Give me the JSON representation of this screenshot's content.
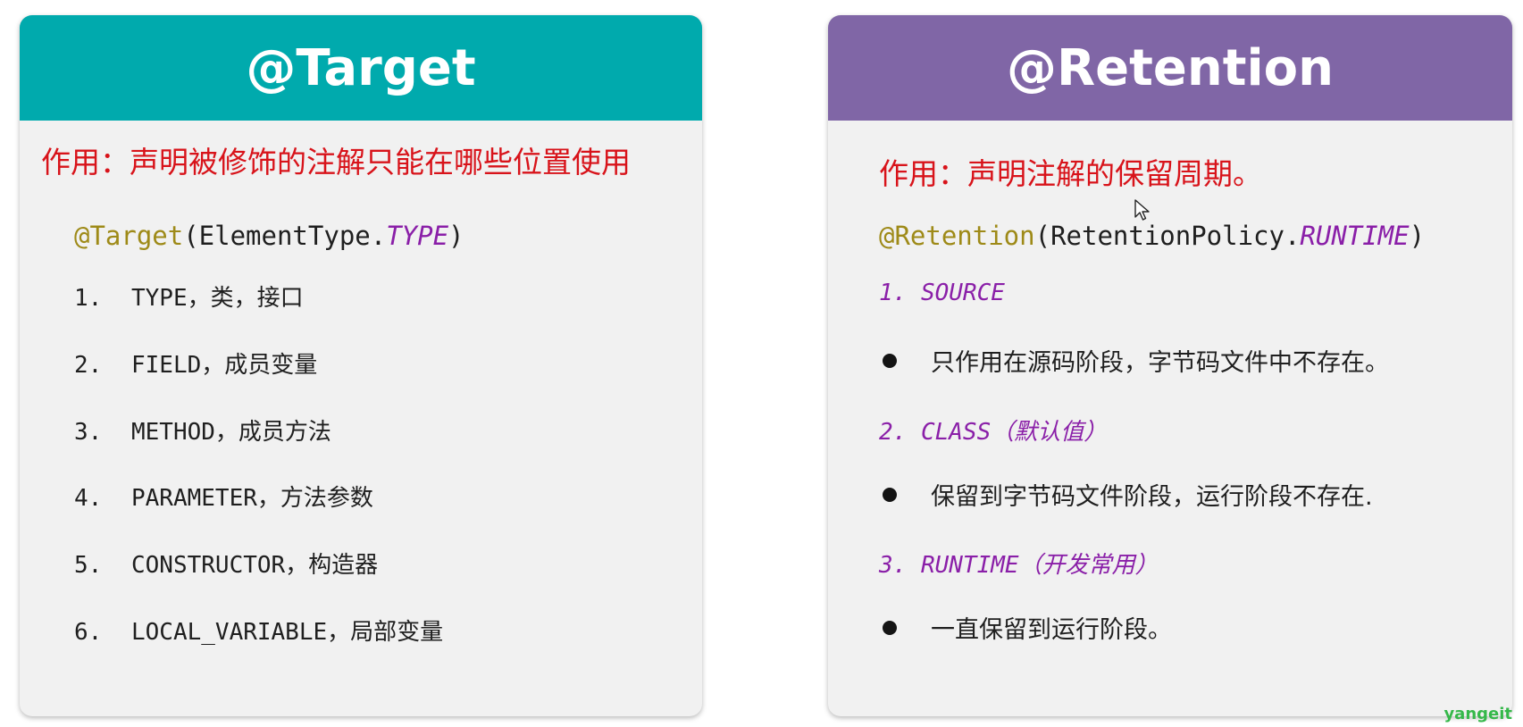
{
  "target_card": {
    "title": "@Target",
    "description": "作用：声明被修饰的注解只能在哪些位置使用",
    "code": {
      "annotation": "@Target",
      "open": "(ElementType.",
      "constant": "TYPE",
      "close": ")"
    },
    "items": [
      {
        "number": "1.",
        "text": "TYPE，类，接口"
      },
      {
        "number": "2.",
        "text": "FIELD，成员变量"
      },
      {
        "number": "3.",
        "text": "METHOD，成员方法"
      },
      {
        "number": "4.",
        "text": "PARAMETER，方法参数"
      },
      {
        "number": "5.",
        "text": "CONSTRUCTOR，构造器"
      },
      {
        "number": "6.",
        "text": "LOCAL_VARIABLE，局部变量"
      }
    ]
  },
  "retention_card": {
    "title": "@Retention",
    "description": "作用：声明注解的保留周期。",
    "code": {
      "annotation": "@Retention",
      "open": "(RetentionPolicy.",
      "constant": "RUNTIME",
      "close": ")"
    },
    "policies": [
      {
        "label": "1. SOURCE",
        "detail": "只作用在源码阶段，字节码文件中不存在。"
      },
      {
        "label": "2. CLASS（默认值）",
        "detail": "保留到字节码文件阶段，运行阶段不存在."
      },
      {
        "label": "3. RUNTIME（开发常用）",
        "detail": "一直保留到运行阶段。"
      }
    ]
  },
  "watermark": "yangeit",
  "colors": {
    "target_header": "#00aaad",
    "retention_header": "#8066a6",
    "description_red": "#d8131a",
    "annotation_olive": "#9e8a18",
    "constant_purple": "#8a1fa8"
  }
}
